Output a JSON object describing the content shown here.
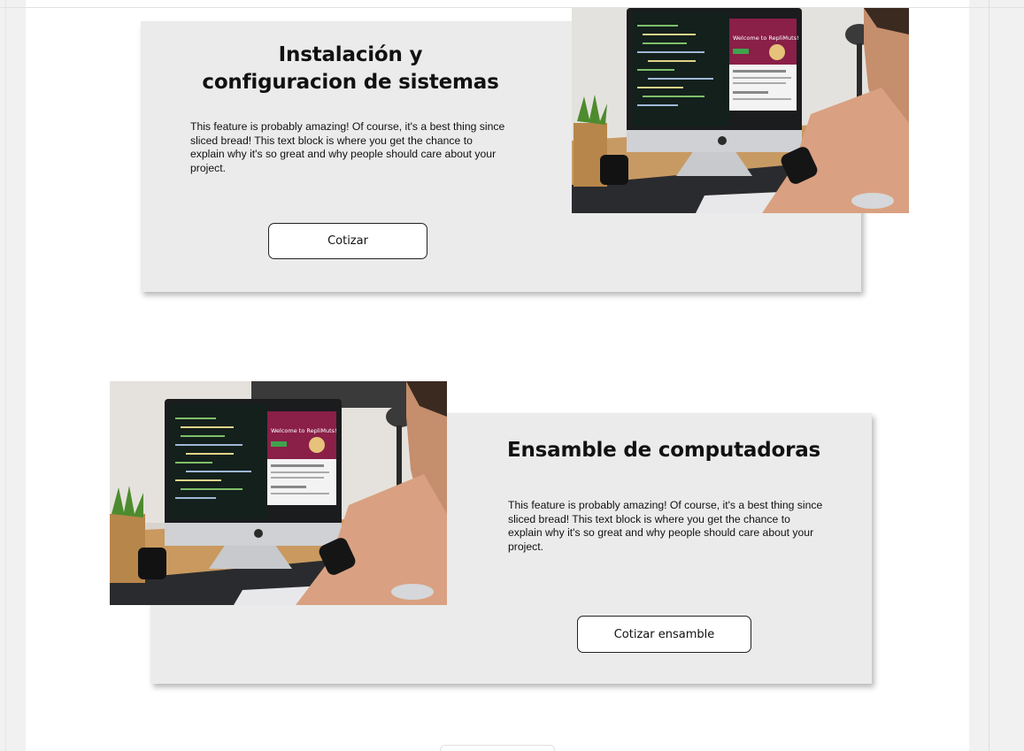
{
  "features": [
    {
      "title": "Instalación y configuracion de sistemas",
      "description": "This feature is probably amazing! Of course, it's a best thing since sliced bread! This text block is where you get the chance to explain why it's so great and why people should care about your project.",
      "button_label": "Cotizar",
      "image_alt": "man-using-imac-photo"
    },
    {
      "title": "Ensamble de computadoras",
      "description": "This feature is probably amazing! Of course, it's a best thing since sliced bread! This text block is where you get the chance to explain why it's so great and why people should care about your project.",
      "button_label": "Cotizar ensamble",
      "image_alt": "man-using-imac-photo"
    }
  ],
  "photo_screen": {
    "welcome_text": "Welcome to RepliMuts!"
  },
  "colors": {
    "page_background": "#f1f1f1",
    "content_background": "#ffffff",
    "card_background": "#ebebeb",
    "button_border": "#222222"
  }
}
